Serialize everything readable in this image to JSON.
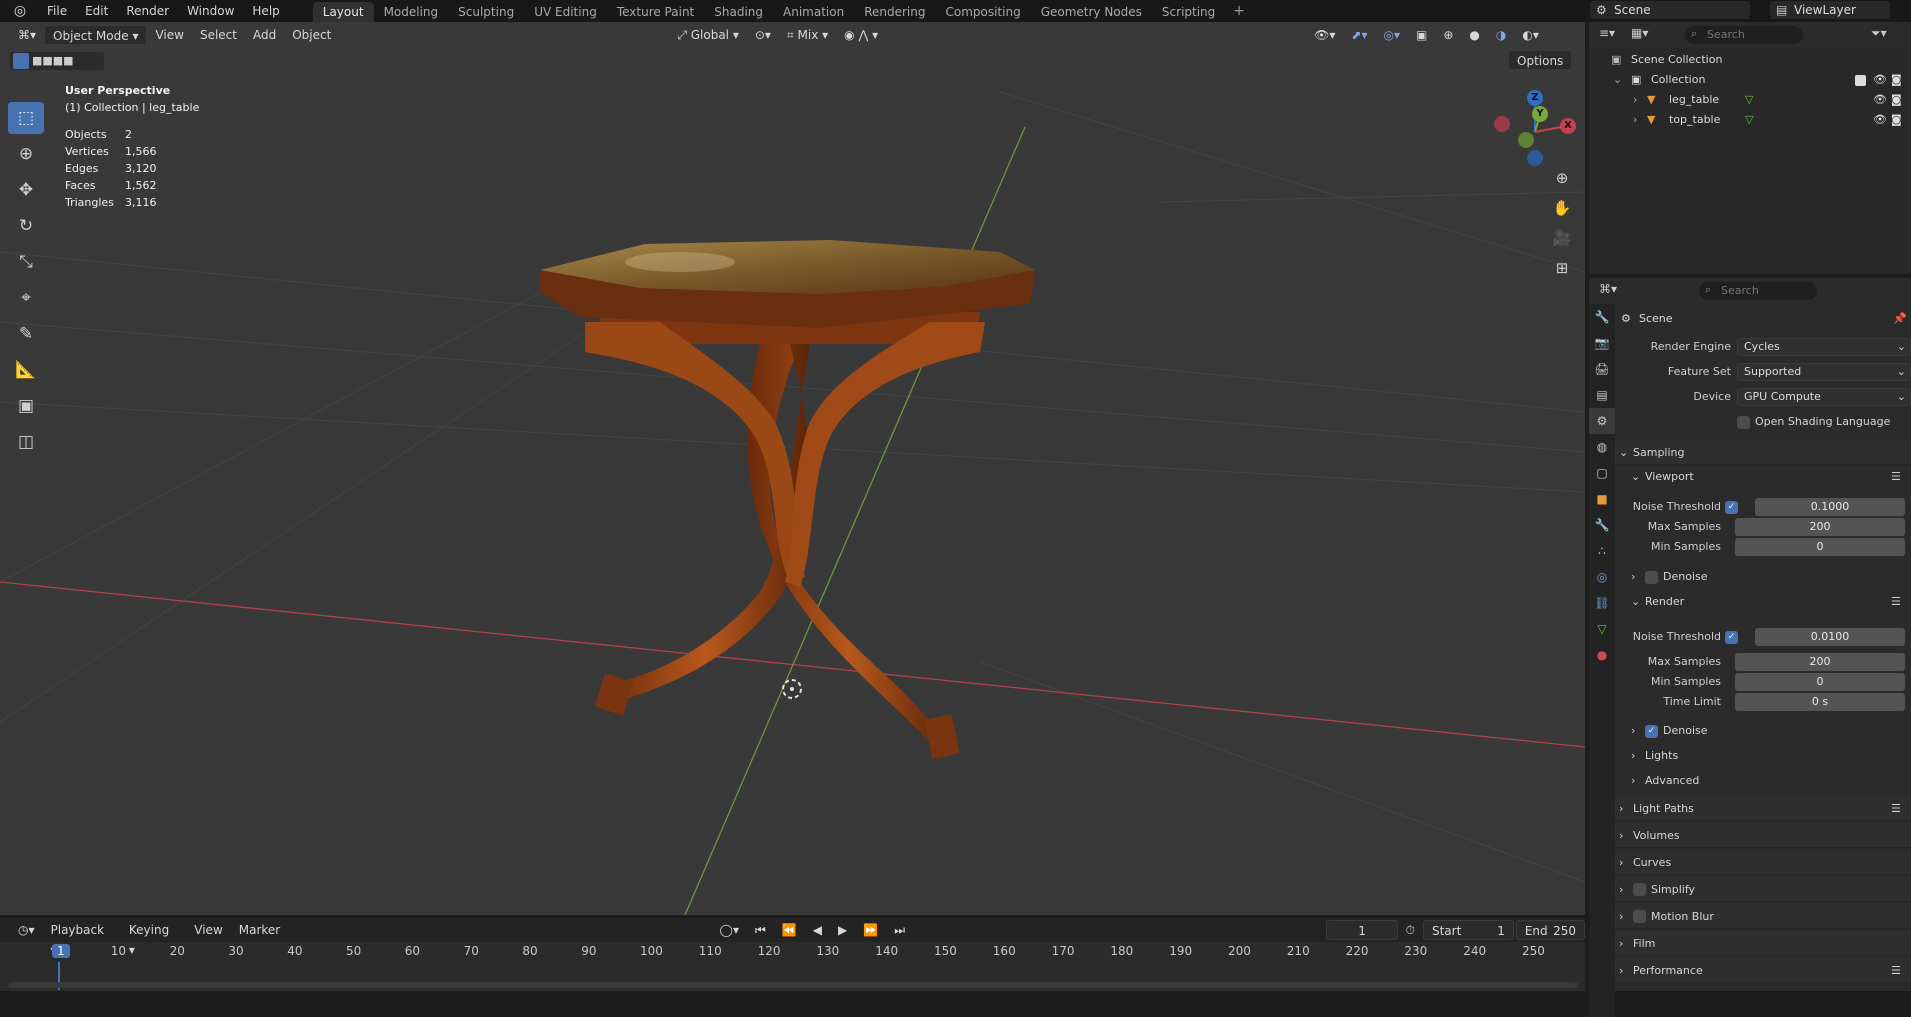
{
  "topbar": {
    "menus": [
      "File",
      "Edit",
      "Render",
      "Window",
      "Help"
    ],
    "workspaces": [
      "Layout",
      "Modeling",
      "Sculpting",
      "UV Editing",
      "Texture Paint",
      "Shading",
      "Animation",
      "Rendering",
      "Compositing",
      "Geometry Nodes",
      "Scripting"
    ],
    "active_workspace": "Layout",
    "scene": "Scene",
    "view_layer": "ViewLayer"
  },
  "viewport_header": {
    "mode": "Object Mode",
    "menus": [
      "View",
      "Select",
      "Add",
      "Object"
    ],
    "orientation": "Global",
    "snap": "Mix",
    "options": "Options"
  },
  "overlay": {
    "title": "User Perspective",
    "subtitle": "(1) Collection | leg_table",
    "stats": [
      {
        "k": "Objects",
        "v": "2"
      },
      {
        "k": "Vertices",
        "v": "1,566"
      },
      {
        "k": "Edges",
        "v": "3,120"
      },
      {
        "k": "Faces",
        "v": "1,562"
      },
      {
        "k": "Triangles",
        "v": "3,116"
      }
    ]
  },
  "gizmo": {
    "z": "Z",
    "y": "Y",
    "x": "X"
  },
  "outliner": {
    "search_placeholder": "Search",
    "root": "Scene Collection",
    "collection": "Collection",
    "objects": [
      "leg_table",
      "top_table"
    ]
  },
  "properties": {
    "search_placeholder": "Search",
    "context": "Scene",
    "render_engine_label": "Render Engine",
    "render_engine": "Cycles",
    "feature_set_label": "Feature Set",
    "feature_set": "Supported",
    "device_label": "Device",
    "device": "GPU Compute",
    "osl_label": "Open Shading Language",
    "sampling": "Sampling",
    "viewport": "Viewport",
    "noise_threshold_label": "Noise Threshold",
    "vp_noise_threshold": "0.1000",
    "max_samples_label": "Max Samples",
    "vp_max_samples": "200",
    "min_samples_label": "Min Samples",
    "vp_min_samples": "0",
    "denoise_label": "Denoise",
    "render": "Render",
    "r_noise_threshold": "0.0100",
    "r_max_samples": "200",
    "r_min_samples": "0",
    "time_limit_label": "Time Limit",
    "r_time_limit": "0 s",
    "lights": "Lights",
    "advanced": "Advanced",
    "panels": [
      "Light Paths",
      "Volumes",
      "Curves",
      "Simplify",
      "Motion Blur",
      "Film",
      "Performance"
    ]
  },
  "timeline": {
    "menus": [
      "Playback",
      "Keying",
      "View",
      "Marker"
    ],
    "current_frame": "1",
    "start_label": "Start",
    "start": "1",
    "end_label": "End",
    "end": "250",
    "ruler": [
      "1",
      "10",
      "20",
      "30",
      "40",
      "50",
      "60",
      "70",
      "80",
      "90",
      "100",
      "110",
      "120",
      "130",
      "140",
      "150",
      "160",
      "170",
      "180",
      "190",
      "200",
      "210",
      "220",
      "230",
      "240",
      "250"
    ]
  },
  "colors": {
    "accent": "#4772b3",
    "x_axis": "#c4414f",
    "y_axis": "#7aa83d",
    "z_axis": "#2f6fc4",
    "wood": "#8a3f14"
  }
}
